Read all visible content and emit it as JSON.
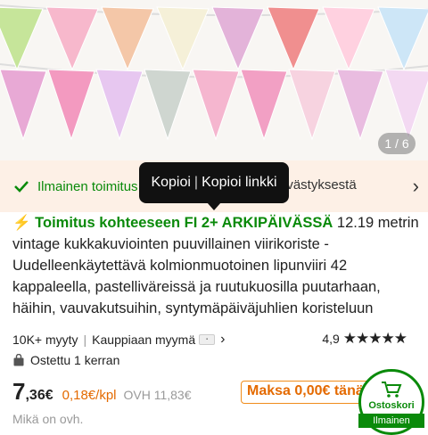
{
  "gallery": {
    "counter": "1 / 6",
    "flag_colors_top": [
      "#c6e59a",
      "#f7b8cc",
      "#f4c7a8",
      "#f5f0d8",
      "#e3b3d9",
      "#f08f8f",
      "#ffd1e0",
      "#cde6f7"
    ],
    "flag_colors_bottom": [
      "#e8a9d5",
      "#f39ac0",
      "#e7c7f0",
      "#cfd6d0",
      "#f5b6cf",
      "#f2a0c4",
      "#f7d3e0",
      "#e9bce0",
      "#f3d9f2"
    ]
  },
  "shipping": {
    "text": "Ilmainen toimitus",
    "tail": "ivästyksestä"
  },
  "tooltip": {
    "copy": "Kopioi",
    "separator": "|",
    "copy_link": "Kopioi linkki"
  },
  "product": {
    "delivery_icon": "bolt-icon",
    "delivery": "Toimitus kohteeseen FI 2+ ARKIPÄIVÄSSÄ",
    "title": " 12.19 metrin vintage kukkakuviointen puuvillainen viirikoriste - Uudelleenkäytettävä kolmionmuotoinen lipunviiri 42 kappaleella, pastelliväreissä ja ruutukuosilla puutarhaan, häihin, vauvakutsuihin, syntymäpäiväjuhlien koristeluun"
  },
  "stats": {
    "sold": "10K+ myyty",
    "seller": "Kauppiaan myymä",
    "rating": "4,9",
    "stars": "★★★★★"
  },
  "bought": "Ostettu 1 kerran",
  "price": {
    "main": "7",
    "cents": ",36€",
    "unit": "0,18€/kpl",
    "old": "OVH 11,83€",
    "pay": "Maksa 0,00€ tänää"
  },
  "question": "Mikä on ovh.",
  "cart": {
    "label": "Ostoskori",
    "sub": "Ilmainen"
  },
  "colors": {
    "accent_green": "#0a8a0a",
    "accent_orange": "#e46a00"
  }
}
